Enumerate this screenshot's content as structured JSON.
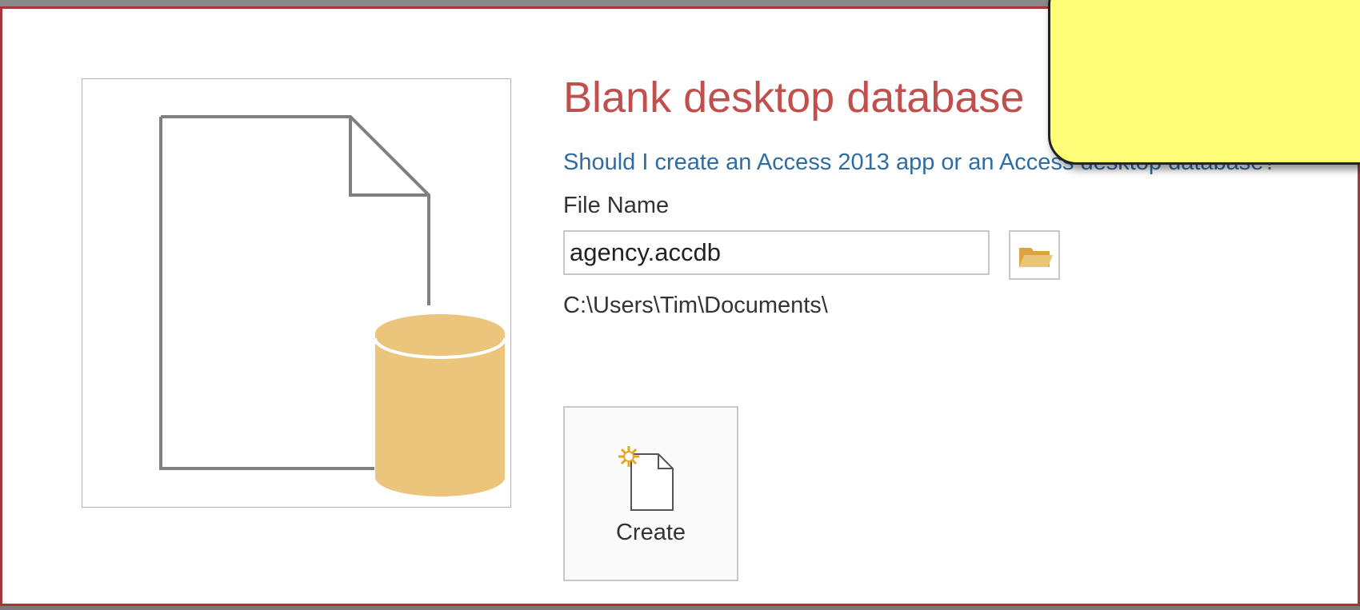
{
  "dialog": {
    "title": "Blank desktop database",
    "help_link": "Should I create an Access 2013 app or an Access desktop database?",
    "file_name_label": "File Name",
    "file_name_value": "agency.accdb",
    "folder_path": "C:\\Users\\Tim\\Documents\\",
    "create_label": "Create"
  },
  "icons": {
    "preview": "blank-database-icon",
    "browse": "folder-icon",
    "create": "new-file-sparkle-icon"
  },
  "colors": {
    "accent_red": "#c0504d",
    "link_blue": "#2e6da4",
    "database_gold": "#ebc57b",
    "note_yellow": "#ffff77"
  }
}
